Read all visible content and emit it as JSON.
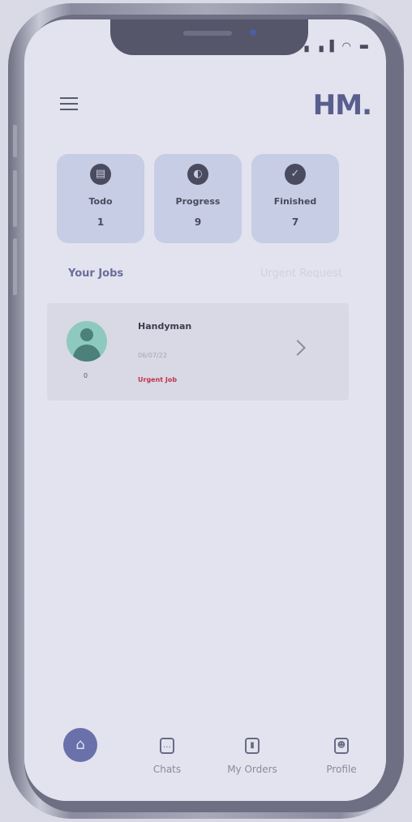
{
  "status_bar": {
    "icons": "▖▗▐ ◠ ▬"
  },
  "app": {
    "logo": "HM."
  },
  "stats": [
    {
      "label": "Todo",
      "value": "1",
      "icon": "clipboard-icon"
    },
    {
      "label": "Progress",
      "value": "9",
      "icon": "progress-icon"
    },
    {
      "label": "Finished",
      "value": "7",
      "icon": "check-icon"
    }
  ],
  "tabs": {
    "your_jobs": "Your Jobs",
    "urgent_request": "Urgent Request"
  },
  "job": {
    "title": "Handyman",
    "date": "06/07/22",
    "badge": "Urgent Job",
    "avatar_number": "0"
  },
  "nav": {
    "home_icon": "home-icon",
    "chats": "Chats",
    "orders": "My Orders",
    "profile": "Profile"
  },
  "colors": {
    "accent": "#6a70aa",
    "card": "#c6cde4",
    "urgent": "#c2344c",
    "avatar": "#8ec9c0"
  }
}
